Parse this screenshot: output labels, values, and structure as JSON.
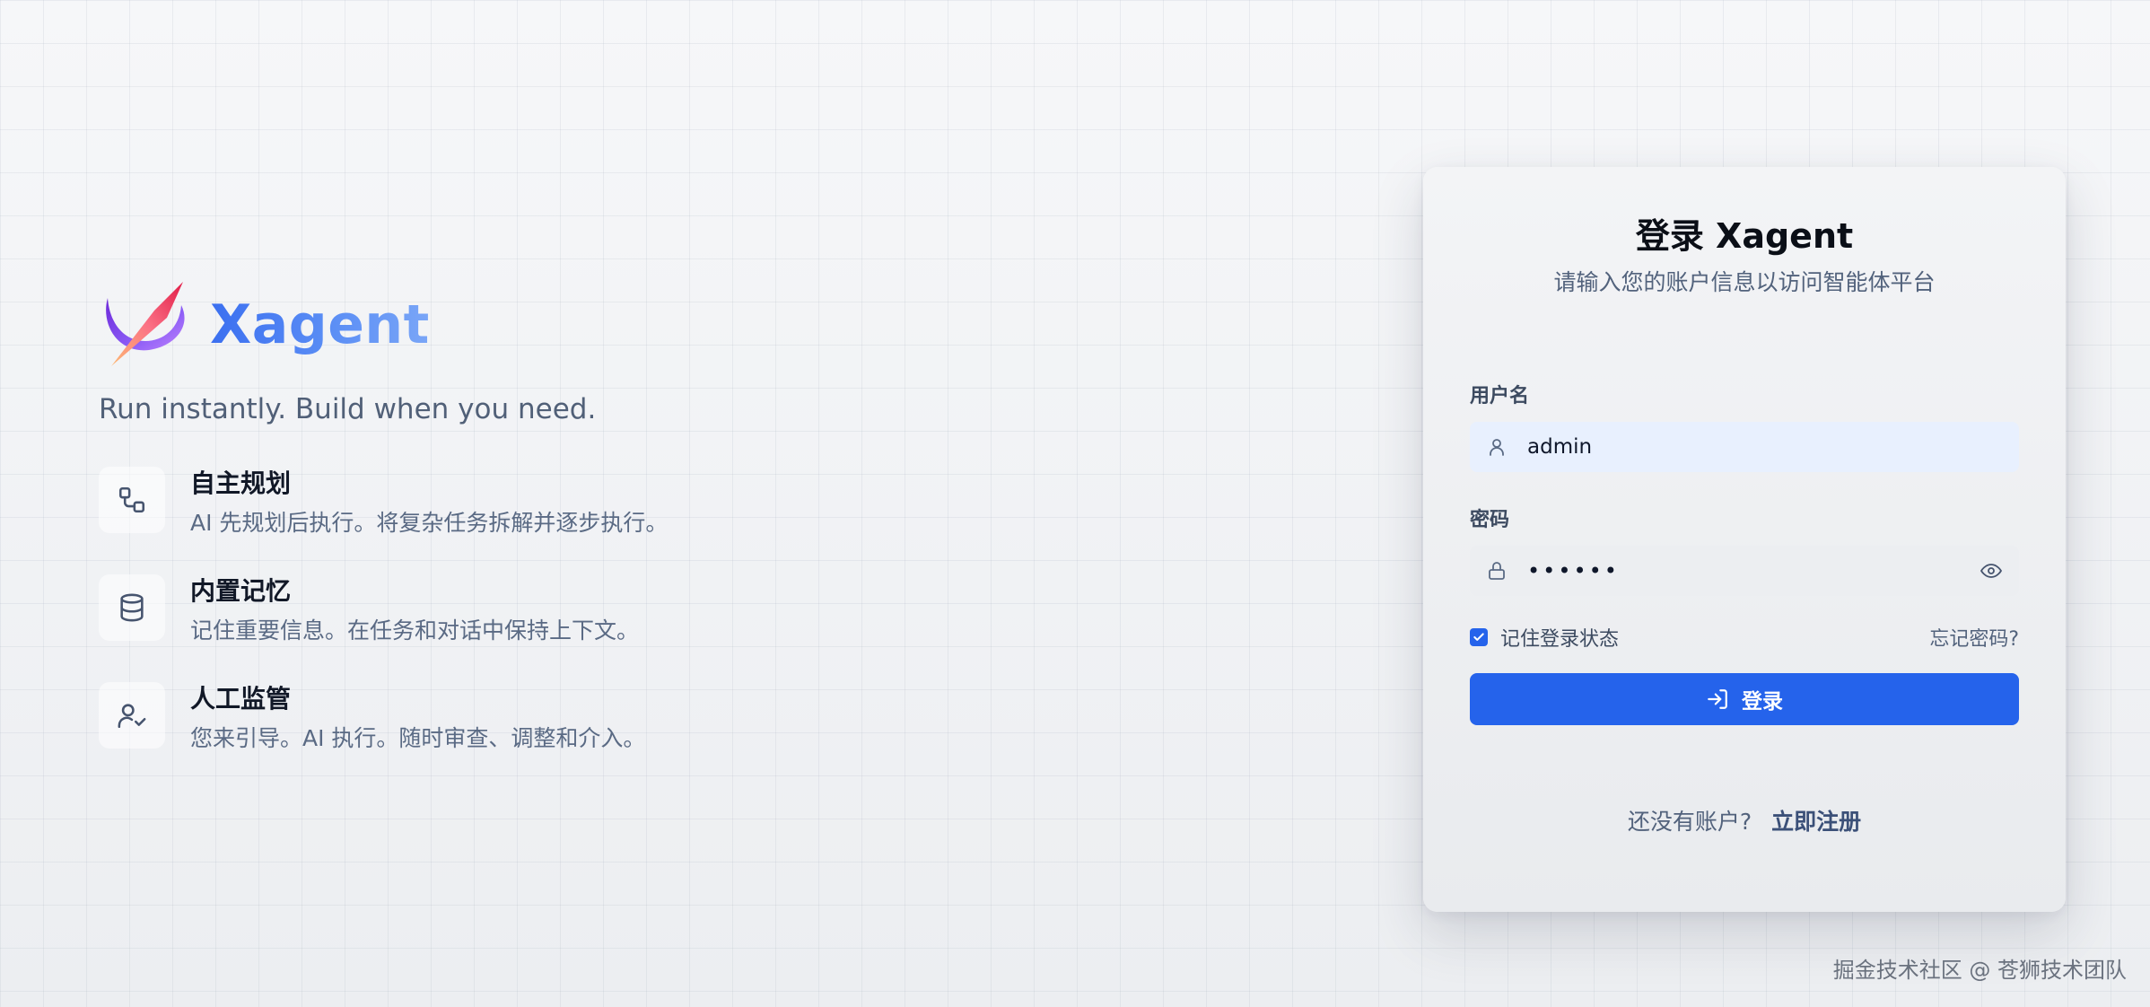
{
  "brand": {
    "name": "Xagent",
    "tagline": "Run instantly. Build when you need.",
    "logo_icon": "xagent-logo-icon"
  },
  "features": [
    {
      "icon": "workflow-icon",
      "title": "自主规划",
      "desc": "AI 先规划后执行。将复杂任务拆解并逐步执行。"
    },
    {
      "icon": "database-icon",
      "title": "内置记忆",
      "desc": "记住重要信息。在任务和对话中保持上下文。"
    },
    {
      "icon": "user-check-icon",
      "title": "人工监管",
      "desc": "您来引导。AI 执行。随时审查、调整和介入。"
    }
  ],
  "login": {
    "title": "登录 Xagent",
    "subtitle": "请输入您的账户信息以访问智能体平台",
    "username_label": "用户名",
    "username_value": "admin",
    "password_label": "密码",
    "password_value": "123456",
    "remember_label": "记住登录状态",
    "remember_checked": true,
    "forgot_label": "忘记密码?",
    "submit_label": "登录",
    "no_account_text": "还没有账户?",
    "register_label": "立即注册"
  },
  "watermark": "掘金技术社区 @ 苍狮技术团队",
  "colors": {
    "primary": "#2563eb",
    "brand_text": "#3b6ff0",
    "input_autofill_bg": "#e8f0fe"
  }
}
